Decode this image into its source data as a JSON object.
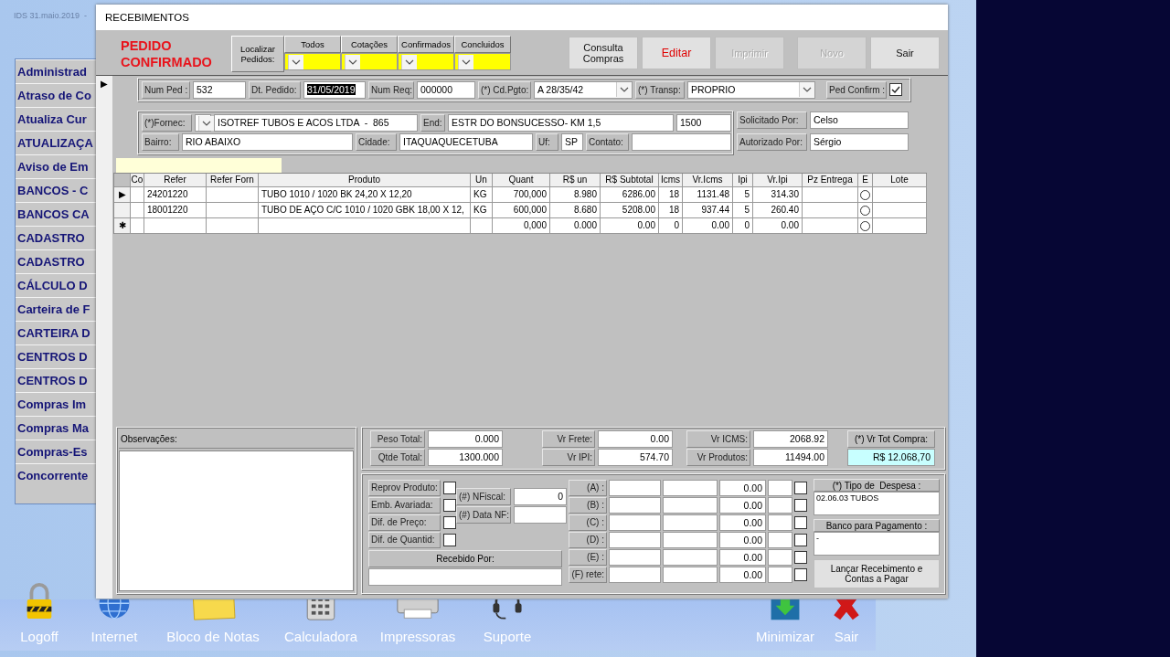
{
  "desktop": {
    "caption": "IDS 31.maio.2019  -"
  },
  "sidebar": {
    "items": [
      "Administrad",
      "Atraso de Co",
      "Atualiza Cur",
      "ATUALIZAÇA",
      "Aviso de Em",
      "BANCOS - C",
      "BANCOS CA",
      "CADASTRO",
      "CADASTRO",
      "CÁLCULO D",
      "Carteira de F",
      "CARTEIRA D",
      "CENTROS D",
      "CENTROS D",
      "Compras Im",
      "Compras Ma",
      "Compras-Es",
      "Concorrente"
    ]
  },
  "taskbar": [
    {
      "label": "Logoff",
      "kind": "lock"
    },
    {
      "label": "Internet",
      "kind": "globe"
    },
    {
      "label": "Bloco de Notas",
      "kind": "note"
    },
    {
      "label": "Calculadora",
      "kind": "calculator"
    },
    {
      "label": "Impressoras",
      "kind": "printer"
    },
    {
      "label": "Suporte",
      "kind": "headset"
    },
    {
      "label": "Minimizar",
      "kind": "minimize"
    },
    {
      "label": "Sair",
      "kind": "exit"
    }
  ],
  "window": {
    "title": "RECEBIMENTOS",
    "status": "PEDIDO CONFIRMADO",
    "record_marker": "▶",
    "finder": {
      "label": "Localizar Pedidos:",
      "filters": [
        "Todos",
        "Cotações",
        "Confirmados",
        "Concluidos"
      ]
    },
    "actions": [
      {
        "label": "Consulta Compras",
        "disabled": false,
        "alert": false
      },
      {
        "label": "Editar",
        "disabled": false,
        "alert": true
      },
      {
        "label": "Imprimir",
        "disabled": true,
        "alert": false
      },
      {
        "label": "Novo",
        "disabled": true,
        "alert": false
      },
      {
        "label": "Sair",
        "disabled": false,
        "alert": false
      }
    ],
    "order": {
      "num_ped": {
        "label": "Num Ped :",
        "value": "532"
      },
      "dt_pedido": {
        "label": "Dt. Pedido:",
        "value": "31/05/2019",
        "selected": true
      },
      "num_req": {
        "label": "Num Req:",
        "value": "000000"
      },
      "cd_pgto": {
        "label": "(*) Cd.Pgto:",
        "value": "A 28/35/42"
      },
      "transp": {
        "label": "(*) Transp:",
        "value": "PROPRIO"
      },
      "ped_confirm": {
        "label": "Ped Confirm :",
        "checked": true
      }
    },
    "supplier": {
      "fornec": {
        "label": "(*)Fornec:",
        "value": "ISOTREF TUBOS E ACOS LTDA  -  865"
      },
      "end": {
        "label": "End:",
        "value": "ESTR DO BONSUCESSO- KM 1,5"
      },
      "numero": {
        "value": "1500"
      },
      "bairro": {
        "label": "Bairro:",
        "value": "RIO ABAIXO"
      },
      "cidade": {
        "label": "Cidade:",
        "value": "ITAQUAQUECETUBA"
      },
      "uf": {
        "label": "Uf:",
        "value": "SP"
      },
      "contato": {
        "label": "Contato:"
      }
    },
    "approvals": {
      "solicitado": {
        "label": "Solicitado Por:",
        "value": "Celso"
      },
      "autorizado": {
        "label": "Autorizado Por:",
        "value": "Sérgio"
      }
    },
    "items_table": {
      "columns": [
        "Co",
        "Refer",
        "Refer Forn",
        "Produto",
        "Un",
        "Quant",
        "R$ un",
        "R$ Subtotal",
        "Icms",
        "Vr.Icms",
        "Ipi",
        "Vr.Ipi",
        "Pz Entrega",
        "E",
        "Lote"
      ],
      "rows": [
        {
          "marker": "▶",
          "refer": "24201220",
          "produto": "TUBO 1010 / 1020 BK 24,20 X 12,20",
          "un": "KG",
          "quant": "700,000",
          "rs_un": "8.980",
          "subtotal": "6286.00",
          "icms": "18",
          "vr_icms": "1131.48",
          "ipi": "5",
          "vr_ipi": "314.30",
          "e_selected": false
        },
        {
          "refer": "18001220",
          "produto": "TUBO DE AÇO C/C 1010 / 1020 GBK 18,00 X 12,",
          "un": "KG",
          "quant": "600,000",
          "rs_un": "8.680",
          "subtotal": "5208.00",
          "icms": "18",
          "vr_icms": "937.44",
          "ipi": "5",
          "vr_ipi": "260.40",
          "e_selected": false
        },
        {
          "marker": "✱",
          "quant": "0,000",
          "rs_un": "0.000",
          "subtotal": "0.00",
          "icms": "0",
          "vr_icms": "0.00",
          "ipi": "0",
          "vr_ipi": "0.00",
          "e_selected": false
        }
      ]
    },
    "notes": {
      "label": "Observações:"
    },
    "totals": [
      {
        "label": "Peso Total:",
        "value": "0.000"
      },
      {
        "label": "Vr Frete:",
        "value": "0.00"
      },
      {
        "label": "Vr ICMS:",
        "value": "2068.92"
      },
      {
        "label": "Qtde Total:",
        "value": "1300.000"
      },
      {
        "label": "Vr IPI:",
        "value": "574.70"
      },
      {
        "label": "Vr Produtos:",
        "value": "11494.00"
      }
    ],
    "grand_total": {
      "label": "(*) Vr Tot Compra:",
      "value": "R$ 12.068,70"
    },
    "checks": [
      {
        "label": "Reprov Produto:",
        "checked": false
      },
      {
        "label": "Emb. Avariada:",
        "checked": false
      },
      {
        "label": "Dif. de Preço:",
        "checked": false
      },
      {
        "label": "Dif. de Quantid:",
        "checked": false
      }
    ],
    "nfiscal": {
      "label": "(#) NFiscal:",
      "value": "0"
    },
    "data_nf": {
      "label": "(#) Data NF:"
    },
    "received_by": {
      "label": "Recebido Por:"
    },
    "expenses": [
      {
        "label": "(A) :",
        "value": "0.00",
        "checked": false
      },
      {
        "label": "(B) :",
        "value": "0.00",
        "checked": false
      },
      {
        "label": "(C) :",
        "value": "0.00",
        "checked": false
      },
      {
        "label": "(D) :",
        "value": "0.00",
        "checked": false
      },
      {
        "label": "(E) :",
        "value": "0.00",
        "checked": false
      },
      {
        "label": "(F) rete:",
        "value": "0.00",
        "checked": false
      }
    ],
    "expense_type": {
      "label": "(*) Tipo de  Despesa :",
      "value": "02.06.03 TUBOS"
    },
    "bank": {
      "label": "Banco para Pagamento :",
      "value": "-"
    },
    "post_button": "Lançar Recebimento e Contas a Pagar"
  }
}
